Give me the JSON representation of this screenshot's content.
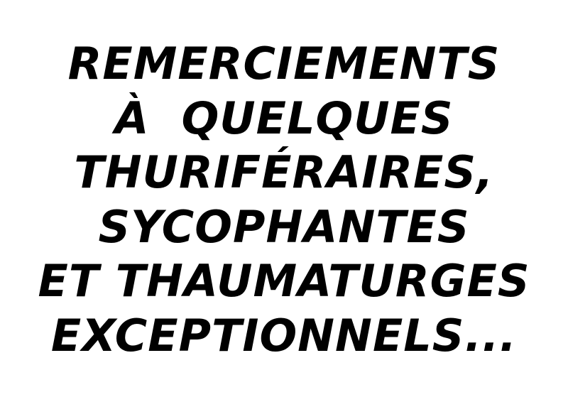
{
  "text_color": "#000000",
  "background_color": "#ffffff",
  "title_lines": [
    "REMERCIEMENTS",
    "À  QUELQUES",
    "THURIFÉRAIRES,",
    "SYCOPHANTES",
    "ET THAUMATURGES",
    "EXCEPTIONNELS..."
  ]
}
